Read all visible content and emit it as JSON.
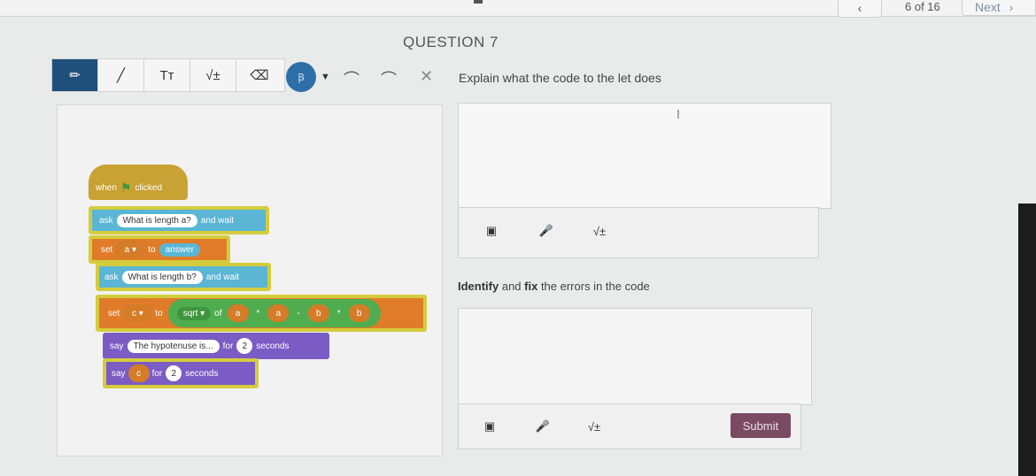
{
  "nav": {
    "prev_icon": "‹",
    "page_count": "6 of 16",
    "next_label": "Next",
    "next_icon": "›"
  },
  "question": {
    "title": "QUESTION 7"
  },
  "toolbar": {
    "tools": [
      {
        "name": "pencil-icon",
        "glyph": "✏"
      },
      {
        "name": "line-icon",
        "glyph": "╱"
      },
      {
        "name": "text-icon",
        "glyph": "Tт"
      },
      {
        "name": "math-icon",
        "glyph": "√±"
      },
      {
        "name": "eraser-icon",
        "glyph": "⌫"
      }
    ],
    "color_label": "Ꞵ",
    "dropdown_icon": "▼",
    "undo_icon": "⌒",
    "redo_icon": "⌒",
    "clear_icon": "✕"
  },
  "scratch": {
    "when_label": "when",
    "flag_icon": "⚑",
    "clicked_label": "clicked",
    "ask1": {
      "ask": "ask",
      "text": "What is length a?",
      "wait": "and wait"
    },
    "set1": {
      "set": "set",
      "var": "a ▾",
      "to": "to",
      "answer": "answer"
    },
    "ask2": {
      "ask": "ask",
      "text": "What is length b?",
      "wait": "and wait"
    },
    "set2": {
      "set": "set",
      "var": "c ▾",
      "to": "to",
      "sqrt": "sqrt ▾",
      "of": "of",
      "a1": "a",
      "times1": "*",
      "a2": "a",
      "minus": "-",
      "b1": "b",
      "times2": "*",
      "b2": "b"
    },
    "say1": {
      "say": "say",
      "text": "The hypotenuse is...",
      "for": "for",
      "num": "2",
      "seconds": "seconds"
    },
    "say2": {
      "say": "say",
      "var": "c",
      "for": "for",
      "num": "2",
      "seconds": "seconds"
    }
  },
  "q1": {
    "prompt": "Explain what the code to the let does",
    "cursor": "I",
    "tools": [
      "▣",
      "🎤",
      "√±"
    ]
  },
  "q2": {
    "prompt_bold1": "Identify",
    "prompt_mid": " and ",
    "prompt_bold2": "fix",
    "prompt_end": " the errors in the code",
    "tools": [
      "▣",
      "🎤",
      "√±"
    ]
  },
  "submit": {
    "label": "Submit"
  },
  "colors": {
    "event": "#c8a233",
    "sensing": "#5ab6d4",
    "variables": "#e07c29",
    "operators": "#4fad4f",
    "looks": "#7b5cc4",
    "submit": "#7a4a63"
  }
}
